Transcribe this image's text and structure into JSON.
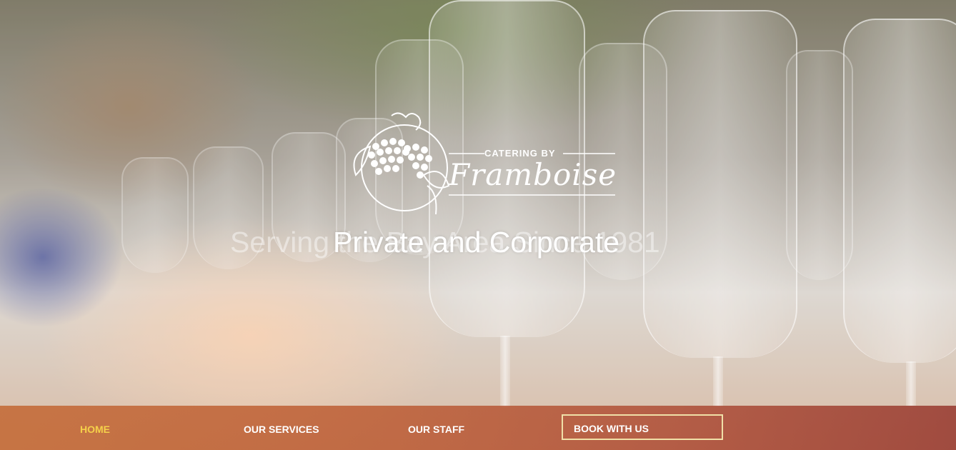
{
  "logo": {
    "small_text": "CATERING BY",
    "name": "Framboise"
  },
  "hero": {
    "tagline_background": "Serving the Bay Area Since 1981",
    "tagline": "Private and Corporate"
  },
  "nav": {
    "items": [
      {
        "label": "HOME",
        "active": true
      },
      {
        "label": "OUR SERVICES",
        "active": false
      },
      {
        "label": "OUR STAFF",
        "active": false
      }
    ],
    "cta": "BOOK WITH US"
  },
  "colors": {
    "nav_bar": "#bd5c36",
    "active_nav": "#f5d04a",
    "cta_border": "#f0e0a8"
  }
}
